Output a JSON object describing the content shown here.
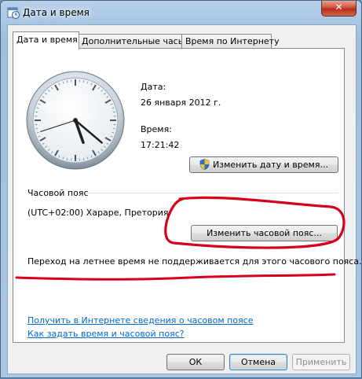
{
  "window": {
    "title": "Дата и время",
    "close_glyph": "✕",
    "icon": "clock-calendar-icon"
  },
  "tabs": [
    {
      "label": "Дата и время",
      "active": true
    },
    {
      "label": "Дополнительные часы",
      "active": false
    },
    {
      "label": "Время по Интернету",
      "active": false
    }
  ],
  "datetime": {
    "date_label": "Дата:",
    "date_value": "26 января 2012 г.",
    "time_label": "Время:",
    "time_value": "17:21:42",
    "change_button": "Изменить дату и время...",
    "change_button_icon": "uac-shield-icon"
  },
  "timezone": {
    "section_label": "Часовой пояс",
    "value": "(UTC+02:00) Хараре, Претория",
    "change_button": "Изменить часовой пояс...",
    "dst_note": "Переход на летнее время не поддерживается для этого часового пояса."
  },
  "links": {
    "internet_info": "Получить в Интернете сведения о часовом поясе",
    "how_to_set": "Как задать время и часовой пояс?"
  },
  "buttons": {
    "ok": "ОК",
    "cancel": "Отмена",
    "apply": "Применить"
  },
  "clock": {
    "hours": 17,
    "minutes": 21,
    "seconds": 42
  },
  "colors": {
    "annotation_red": "#d6001c",
    "link_blue": "#0066cc",
    "accent_titlebar": "#a9c6e4"
  }
}
